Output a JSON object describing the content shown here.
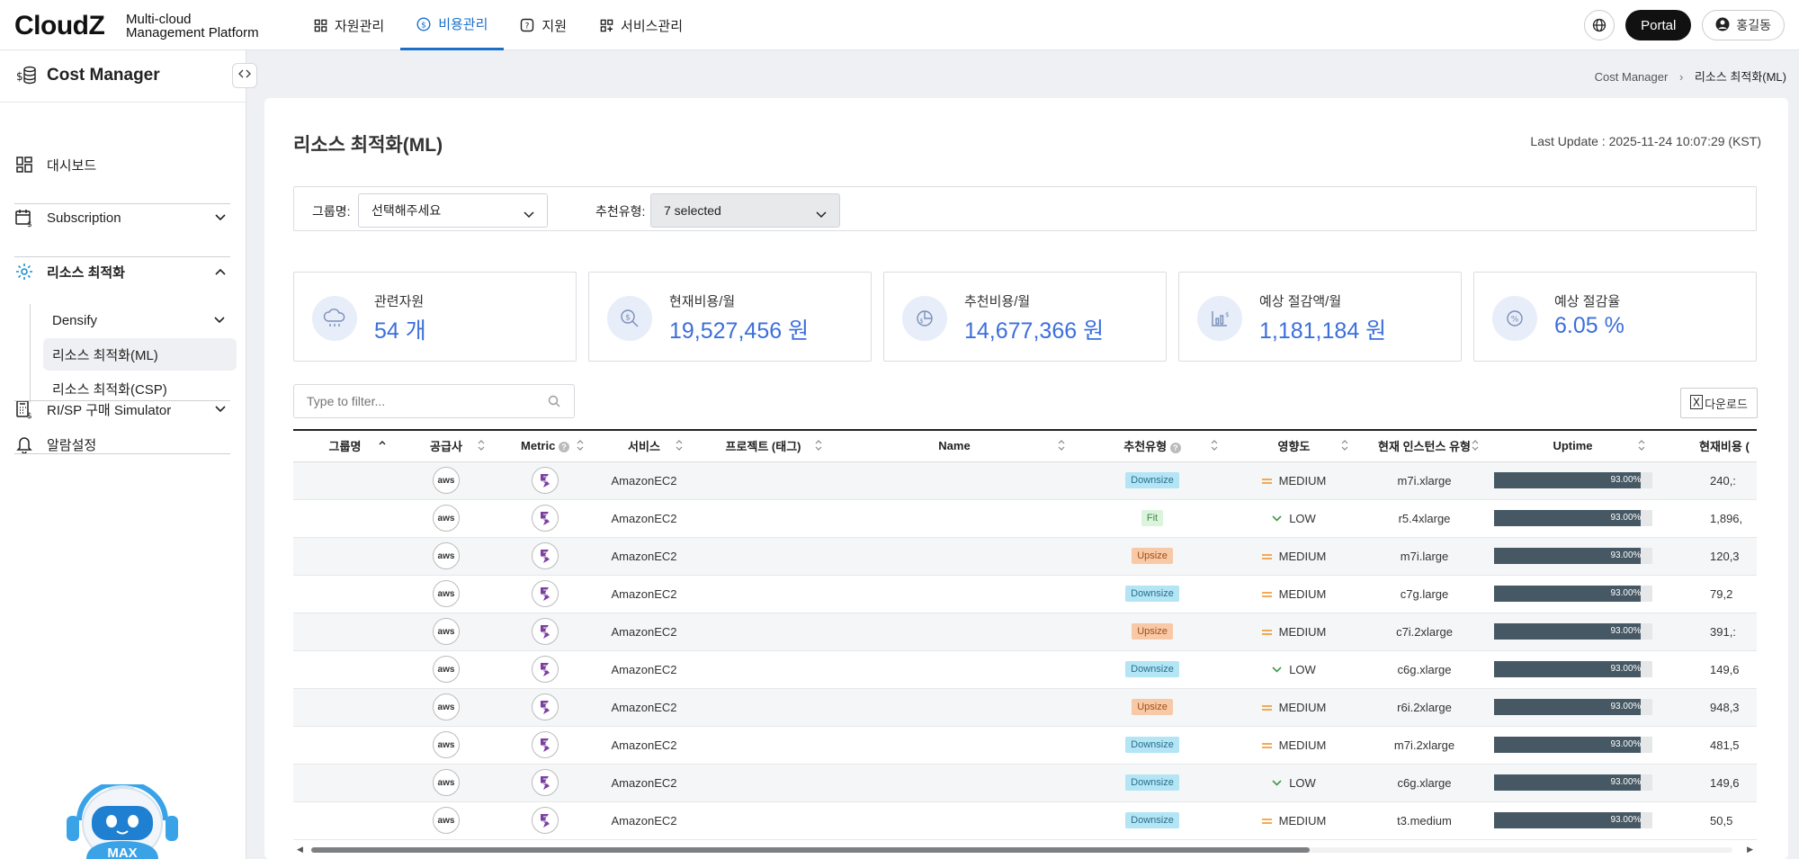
{
  "brand": {
    "logo": "CloudZ",
    "subtitle": "Multi-cloud\nManagement Platform"
  },
  "nav": [
    {
      "label": "자원관리",
      "icon": "grid-icon",
      "active": false
    },
    {
      "label": "비용관리",
      "icon": "dollar-icon",
      "active": true
    },
    {
      "label": "지원",
      "icon": "help-icon",
      "active": false
    },
    {
      "label": "서비스관리",
      "icon": "apps-plus-icon",
      "active": false
    }
  ],
  "header": {
    "portal": "Portal",
    "user": "홍길동"
  },
  "sidebar": {
    "title": "Cost Manager",
    "items": [
      {
        "label": "대시보드",
        "icon": "dashboard-icon"
      },
      {
        "label": "Subscription",
        "icon": "calendar-dollar-icon"
      },
      {
        "label": "리소스 최적화",
        "icon": "gear-cycle-icon"
      },
      {
        "label": "Densify"
      },
      {
        "label": "리소스 최적화(ML)"
      },
      {
        "label": "리소스 최적화(CSP)"
      },
      {
        "label": "RI/SP 구매 Simulator",
        "icon": "calculator-icon"
      },
      {
        "label": "알람설정",
        "icon": "bell-icon"
      }
    ],
    "robot_label": "MAX"
  },
  "breadcrumb": {
    "root": "Cost Manager",
    "current": "리소스 최적화(ML)"
  },
  "page": {
    "title": "리소스 최적화(ML)",
    "last_update": "Last Update : 2025-11-24 10:07:29 (KST)"
  },
  "filters": {
    "group_label": "그룹명:",
    "group_value": "선택해주세요",
    "type_label": "추천유형:",
    "type_value": "7 selected"
  },
  "stats": [
    {
      "label": "관련자원",
      "value": "54 개",
      "icon": "cloud-icon"
    },
    {
      "label": "현재비용/월",
      "value": "19,527,456 원",
      "icon": "search-dollar-icon"
    },
    {
      "label": "추천비용/월",
      "value": "14,677,366 원",
      "icon": "pie-dollar-icon"
    },
    {
      "label": "예상 절감액/월",
      "value": "1,181,184 원",
      "icon": "chart-down-icon"
    },
    {
      "label": "예상 절감율",
      "value": "6.05 %",
      "icon": "percent-icon"
    }
  ],
  "search": {
    "placeholder": "Type to filter..."
  },
  "download": {
    "label": "다운로드"
  },
  "table": {
    "columns": [
      "그룹명",
      "공급사",
      "Metric",
      "서비스",
      "프로젝트 (태그)",
      "Name",
      "추천유형",
      "영향도",
      "현재 인스턴스 유형",
      "Uptime",
      "현재비용 ("
    ],
    "rows": [
      {
        "vendor": "aws",
        "service": "AmazonEC2",
        "type": "Downsize",
        "impact": "MEDIUM",
        "instance": "m7i.xlarge",
        "uptime": "93.00%",
        "cost": "240,:"
      },
      {
        "vendor": "aws",
        "service": "AmazonEC2",
        "type": "Fit",
        "impact": "LOW",
        "instance": "r5.4xlarge",
        "uptime": "93.00%",
        "cost": "1,896,"
      },
      {
        "vendor": "aws",
        "service": "AmazonEC2",
        "type": "Upsize",
        "impact": "MEDIUM",
        "instance": "m7i.large",
        "uptime": "93.00%",
        "cost": "120,3"
      },
      {
        "vendor": "aws",
        "service": "AmazonEC2",
        "type": "Downsize",
        "impact": "MEDIUM",
        "instance": "c7g.large",
        "uptime": "93.00%",
        "cost": "79,2"
      },
      {
        "vendor": "aws",
        "service": "AmazonEC2",
        "type": "Upsize",
        "impact": "MEDIUM",
        "instance": "c7i.2xlarge",
        "uptime": "93.00%",
        "cost": "391,:"
      },
      {
        "vendor": "aws",
        "service": "AmazonEC2",
        "type": "Downsize",
        "impact": "LOW",
        "instance": "c6g.xlarge",
        "uptime": "93.00%",
        "cost": "149,6"
      },
      {
        "vendor": "aws",
        "service": "AmazonEC2",
        "type": "Upsize",
        "impact": "MEDIUM",
        "instance": "r6i.2xlarge",
        "uptime": "93.00%",
        "cost": "948,3"
      },
      {
        "vendor": "aws",
        "service": "AmazonEC2",
        "type": "Downsize",
        "impact": "MEDIUM",
        "instance": "m7i.2xlarge",
        "uptime": "93.00%",
        "cost": "481,5"
      },
      {
        "vendor": "aws",
        "service": "AmazonEC2",
        "type": "Downsize",
        "impact": "LOW",
        "instance": "c6g.xlarge",
        "uptime": "93.00%",
        "cost": "149,6"
      },
      {
        "vendor": "aws",
        "service": "AmazonEC2",
        "type": "Downsize",
        "impact": "MEDIUM",
        "instance": "t3.medium",
        "uptime": "93.00%",
        "cost": "50,5"
      }
    ]
  },
  "colors": {
    "accent": "#1a6fc9",
    "stat_value": "#3b6fdc",
    "uptime_fill": "#465864",
    "impact_medium": "#f0a040",
    "impact_low": "#3f9a46"
  }
}
